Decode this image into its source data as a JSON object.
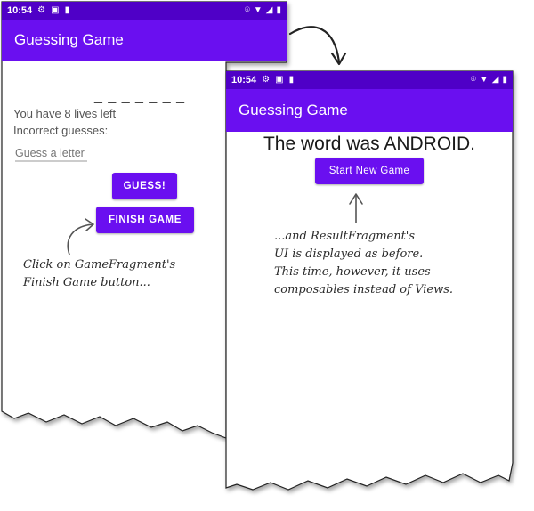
{
  "colors": {
    "primary": "#6a0ff0",
    "status_bar": "#4f00c7",
    "text_secondary": "#555555"
  },
  "left_phone": {
    "status_bar": {
      "time": "10:54",
      "icons": [
        "gear-icon",
        "notification-icon",
        "sd-card-icon",
        "location-icon",
        "wifi-icon",
        "battery-icon"
      ]
    },
    "app_title": "Guessing Game",
    "secret_word": "_ _ _ _ _ _ _",
    "lives_text": "You have 8 lives left",
    "incorrect_label": "Incorrect guesses:",
    "guess_placeholder": "Guess a letter",
    "guess_button": "GUESS!",
    "finish_button": "FINISH GAME"
  },
  "right_phone": {
    "status_bar": {
      "time": "10:54",
      "icons": [
        "gear-icon",
        "notification-icon",
        "sd-card-icon",
        "location-icon",
        "wifi-icon",
        "battery-icon"
      ]
    },
    "app_title": "Guessing Game",
    "result_text": "The word was ANDROID.",
    "new_game_button": "Start New Game"
  },
  "annotations": {
    "left_note": [
      "Click on GameFragment's",
      "Finish Game button..."
    ],
    "right_note": [
      "...and ResultFragment's",
      "UI is displayed as before.",
      "This time, however, it uses",
      "composables instead of Views."
    ]
  }
}
